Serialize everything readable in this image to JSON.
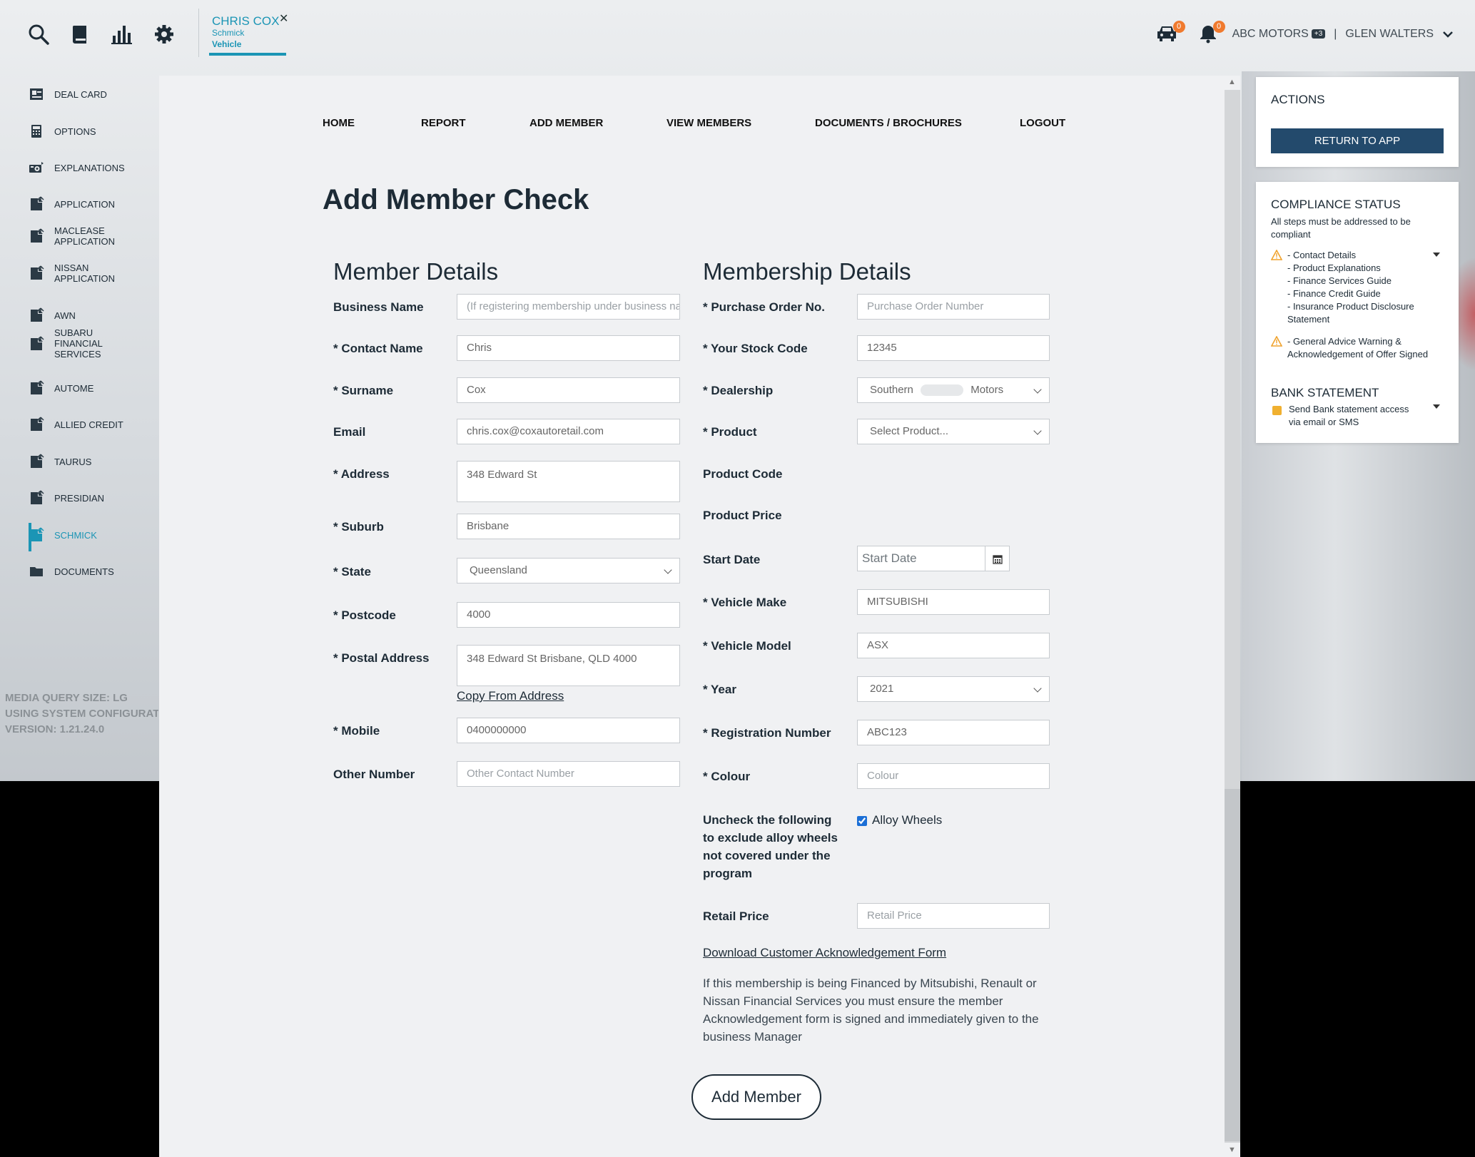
{
  "header": {
    "tab": {
      "name": "CHRIS COX",
      "sub1": "Schmick",
      "sub2": "Vehicle"
    },
    "car_badge": "0",
    "bell_badge": "0",
    "company": "ABC MOTORS",
    "company_tag": "+3",
    "separator": "|",
    "user": "GLEN WALTERS"
  },
  "sidebar": {
    "items": [
      {
        "label": "DEAL CARD"
      },
      {
        "label": "OPTIONS"
      },
      {
        "label": "EXPLANATIONS"
      },
      {
        "label": "APPLICATION"
      },
      {
        "label": "MACLEASE\nAPPLICATION"
      },
      {
        "label": "NISSAN\nAPPLICATION"
      },
      {
        "label": "AWN"
      },
      {
        "label": "SUBARU\nFINANCIAL\nSERVICES"
      },
      {
        "label": "AUTOME"
      },
      {
        "label": "ALLIED CREDIT"
      },
      {
        "label": "TAURUS"
      },
      {
        "label": "PRESIDIAN"
      },
      {
        "label": "SCHMICK"
      },
      {
        "label": "DOCUMENTS"
      }
    ],
    "debug": [
      "MEDIA QUERY SIZE: LG",
      "USING SYSTEM CONFIGURAT",
      "VERSION: 1.21.24.0"
    ]
  },
  "nav": [
    "HOME",
    "REPORT",
    "ADD MEMBER",
    "VIEW MEMBERS",
    "DOCUMENTS / BROCHURES",
    "LOGOUT"
  ],
  "page_title": "Add Member Check",
  "member": {
    "heading": "Member Details",
    "business_name": {
      "label": "Business Name",
      "placeholder": "(If registering membership under business name)"
    },
    "contact_name": {
      "label": "* Contact Name",
      "value": "Chris"
    },
    "surname": {
      "label": "* Surname",
      "value": "Cox"
    },
    "email": {
      "label": "Email",
      "value": "chris.cox@coxautoretail.com"
    },
    "address": {
      "label": "* Address",
      "value": "348 Edward St"
    },
    "suburb": {
      "label": "* Suburb",
      "value": "Brisbane"
    },
    "state": {
      "label": "* State",
      "value": "Queensland"
    },
    "postcode": {
      "label": "* Postcode",
      "value": "4000"
    },
    "postal_address": {
      "label": "* Postal Address",
      "value": "348 Edward St Brisbane, QLD 4000"
    },
    "copy_from_address": "Copy From Address",
    "mobile": {
      "label": "* Mobile",
      "value": "0400000000"
    },
    "other_number": {
      "label": "Other Number",
      "placeholder": "Other Contact Number"
    }
  },
  "membership": {
    "heading": "Membership Details",
    "po": {
      "label": "* Purchase Order No.",
      "placeholder": "Purchase Order Number"
    },
    "stock": {
      "label": "* Your Stock Code",
      "value": "12345"
    },
    "dealership": {
      "label": "* Dealership",
      "value_a": "Southern",
      "value_b": "Motors"
    },
    "product": {
      "label": "* Product",
      "value": "Select Product..."
    },
    "product_code": {
      "label": "Product Code"
    },
    "product_price": {
      "label": "Product Price"
    },
    "start_date": {
      "label": "Start Date",
      "placeholder": "Start Date"
    },
    "make": {
      "label": "* Vehicle Make",
      "value": "MITSUBISHI"
    },
    "model": {
      "label": "* Vehicle Model",
      "value": "ASX"
    },
    "year": {
      "label": "* Year",
      "value": "2021"
    },
    "rego": {
      "label": "* Registration Number",
      "value": "ABC123"
    },
    "colour": {
      "label": "* Colour",
      "placeholder": "Colour"
    },
    "alloy_note": "Uncheck the following to exclude alloy wheels not covered under the program",
    "alloy_label": "Alloy Wheels",
    "retail_price": {
      "label": "Retail Price",
      "placeholder": "Retail Price"
    },
    "download_link": "Download Customer Acknowledgement Form",
    "finance_note": "If this membership is being Financed by Mitsubishi, Renault or Nissan Financial Services you must ensure the member Acknowledgement form is signed and immediately given to the business Manager"
  },
  "submit_label": "Add Member",
  "actions": {
    "title": "ACTIONS",
    "return_label": "RETURN TO APP"
  },
  "compliance": {
    "title": "COMPLIANCE STATUS",
    "subtitle": "All steps must be addressed to be compliant",
    "group1": [
      "- Contact Details",
      "- Product Explanations",
      "- Finance Services Guide",
      "- Finance Credit Guide",
      "- Insurance Product Disclosure",
      "Statement"
    ],
    "group2": [
      "- General Advice Warning &",
      "Acknowledgement of Offer Signed"
    ],
    "bank_title": "BANK STATEMENT",
    "bank_text": [
      "Send Bank statement access",
      "via email or SMS"
    ]
  },
  "colors": {
    "accent": "#1b95b5",
    "button": "#234a6c",
    "badge": "#f07a2e",
    "warning": "#f0a32e"
  }
}
